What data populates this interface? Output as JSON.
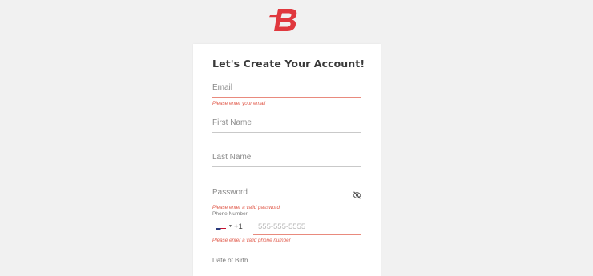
{
  "brand": {
    "logo_icon": "red-b-logo-icon",
    "accent_color": "#e0383e"
  },
  "form": {
    "title": "Let's Create Your Account!",
    "email": {
      "placeholder": "Email",
      "error": "Please enter your email"
    },
    "first_name": {
      "placeholder": "First Name"
    },
    "last_name": {
      "placeholder": "Last Name"
    },
    "password": {
      "placeholder": "Password",
      "error": "Please enter a valid password",
      "toggle_icon": "eye-slash-icon"
    },
    "phone": {
      "label": "Phone Number",
      "country_flag": "us-flag-icon",
      "dial_code": "+1",
      "placeholder": "555-555-5555",
      "error": "Please enter a valid phone number"
    },
    "next_label": "Date of Birth"
  },
  "colors": {
    "error": "#e0594a",
    "error_underline": "#e98a7d",
    "background": "#f1f1f1",
    "card": "#ffffff"
  }
}
